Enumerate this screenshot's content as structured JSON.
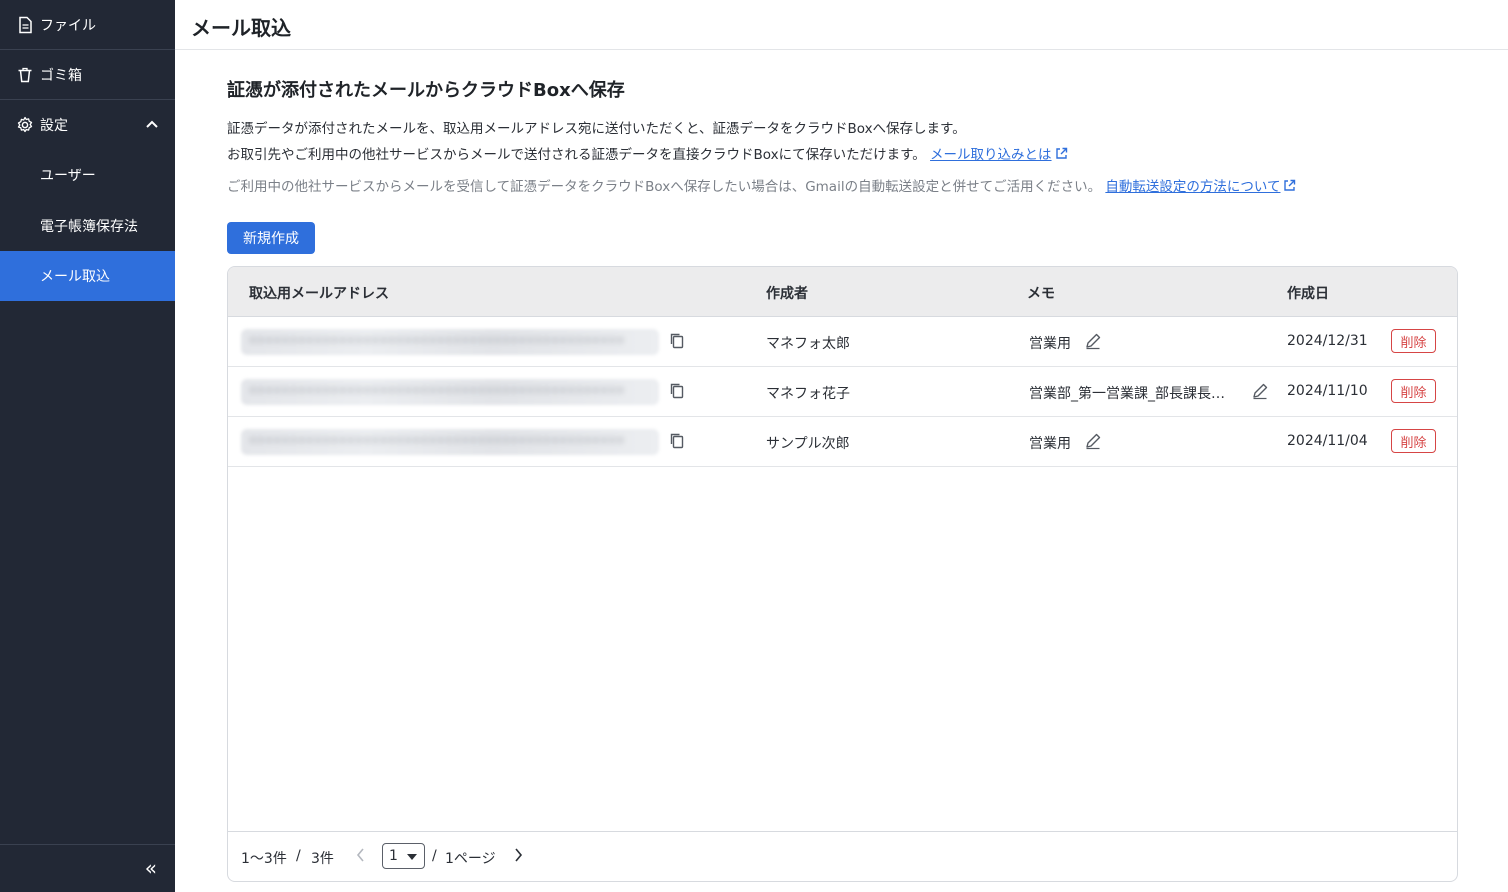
{
  "sidebar": {
    "items": [
      {
        "label": "ファイル",
        "icon": "file-icon"
      },
      {
        "label": "ゴミ箱",
        "icon": "trash-icon"
      },
      {
        "label": "設定",
        "icon": "gear-icon",
        "expanded": true
      },
      {
        "label": "ユーザー"
      },
      {
        "label": "電子帳簿保存法"
      },
      {
        "label": "メール取込",
        "active": true
      }
    ],
    "collapse_icon": "«"
  },
  "header": {
    "title": "メール取込"
  },
  "main": {
    "section_title": "証憑が添付されたメールからクラウドBoxへ保存",
    "desc_line1": "証憑データが添付されたメールを、取込用メールアドレス宛に送付いただくと、証憑データをクラウドBoxへ保存します。",
    "desc_line2": "お取引先やご利用中の他社サービスからメールで送付される証憑データを直接クラウドBoxにて保存いただけます。",
    "desc_line2_link": "メール取り込みとは",
    "desc_line3": "ご利用中の他社サービスからメールを受信して証憑データをクラウドBoxへ保存したい場合は、Gmailの自動転送設定と併せてご活用ください。",
    "desc_line3_link": "自動転送設定の方法について",
    "new_button": "新規作成"
  },
  "table": {
    "headers": [
      "取込用メールアドレス",
      "作成者",
      "メモ",
      "作成日"
    ],
    "rows": [
      {
        "creator": "マネフォ太郎",
        "memo": "営業用",
        "date": "2024/12/31",
        "delete": "削除"
      },
      {
        "creator": "マネフォ花子",
        "memo": "営業部_第一営業課_部長課長…",
        "date": "2024/11/10",
        "delete": "削除"
      },
      {
        "creator": "サンプル次郎",
        "memo": "営業用",
        "date": "2024/11/04",
        "delete": "削除"
      }
    ]
  },
  "pagination": {
    "range": "1〜3件",
    "separator": "/",
    "total": "3件",
    "current_page": "1",
    "page_sep": "/",
    "total_pages": "1ページ"
  },
  "colors": {
    "sidebar_bg": "#222835",
    "accent": "#2f6fdc",
    "danger": "#d64545"
  }
}
